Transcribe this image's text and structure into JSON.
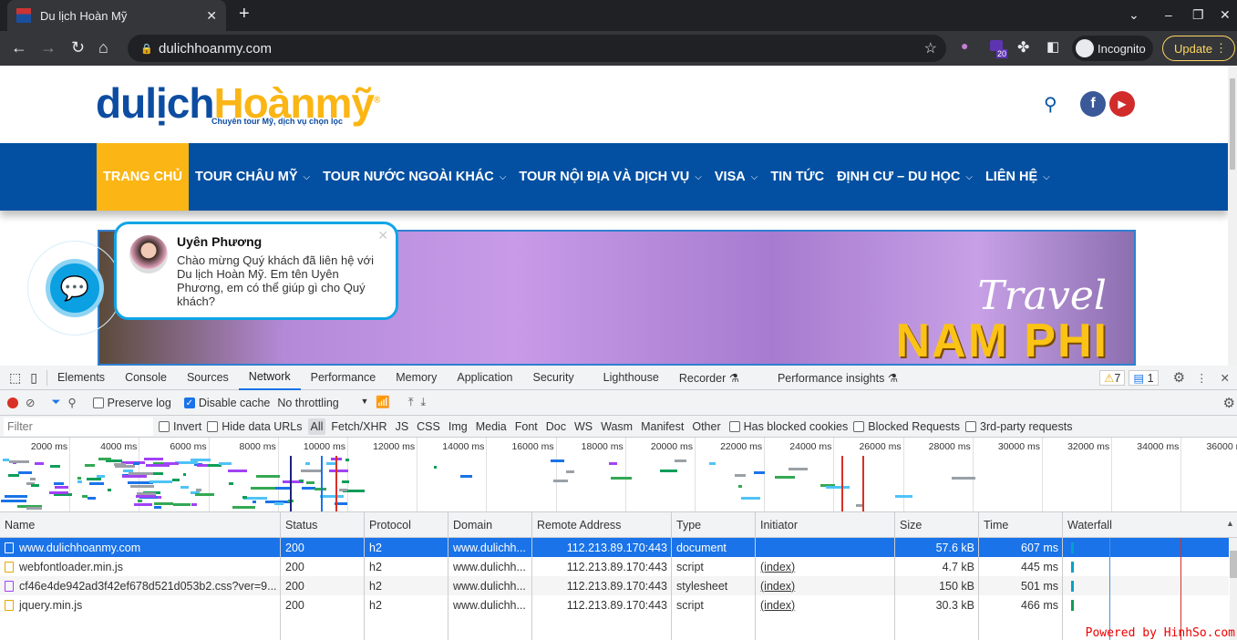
{
  "browser": {
    "tab_title": "Du lịch Hoàn Mỹ",
    "url": "dulichhoanmy.com",
    "incognito_label": "Incognito",
    "update_label": "Update",
    "extension_badge": "20"
  },
  "site": {
    "logo_part1": "dulịch",
    "logo_part2": "Hoànmỹ",
    "logo_mark": "®",
    "slogan": "Chuyên tour Mỹ, dịch vụ chọn lọc",
    "nav": [
      {
        "label": "TRANG CHỦ",
        "active": true,
        "dropdown": false
      },
      {
        "label": "TOUR CHÂU MỸ",
        "dropdown": true
      },
      {
        "label": "TOUR NƯỚC NGOÀI KHÁC",
        "dropdown": true
      },
      {
        "label": "TOUR NỘI ĐỊA VÀ DỊCH VỤ",
        "dropdown": true
      },
      {
        "label": "VISA",
        "dropdown": true
      },
      {
        "label": "TIN TỨC",
        "dropdown": false
      },
      {
        "label": "ĐỊNH CƯ – DU HỌC",
        "dropdown": true
      },
      {
        "label": "LIÊN HỆ",
        "dropdown": true
      }
    ],
    "banner": {
      "line1": "Travel",
      "line2": "NAM PHI"
    },
    "chat": {
      "name": "Uyên Phương",
      "message": "Chào mừng Quý khách đã liên hệ với Du lịch Hoàn Mỹ. Em tên Uyên Phương, em có thể giúp gì cho Quý khách?"
    }
  },
  "devtools": {
    "tabs": [
      "Elements",
      "Console",
      "Sources",
      "Network",
      "Performance",
      "Memory",
      "Application",
      "Security",
      "Lighthouse",
      "Recorder ⚗",
      "Performance insights ⚗"
    ],
    "selected_tab": "Network",
    "warnings": "7",
    "messages": "1",
    "toolbar": {
      "preserve_log": "Preserve log",
      "disable_cache": "Disable cache",
      "throttling": "No throttling"
    },
    "filter": {
      "placeholder": "Filter",
      "invert": "Invert",
      "hide_data_urls": "Hide data URLs",
      "types": [
        "All",
        "Fetch/XHR",
        "JS",
        "CSS",
        "Img",
        "Media",
        "Font",
        "Doc",
        "WS",
        "Wasm",
        "Manifest",
        "Other"
      ],
      "has_blocked_cookies": "Has blocked cookies",
      "blocked_requests": "Blocked Requests",
      "third_party": "3rd-party requests"
    },
    "timeline_ticks": [
      "2000 ms",
      "4000 ms",
      "6000 ms",
      "8000 ms",
      "10000 ms",
      "12000 ms",
      "14000 ms",
      "16000 ms",
      "18000 ms",
      "20000 ms",
      "22000 ms",
      "24000 ms",
      "26000 ms",
      "28000 ms",
      "30000 ms",
      "32000 ms",
      "34000 ms",
      "36000 ms"
    ],
    "columns": [
      "Name",
      "Status",
      "Protocol",
      "Domain",
      "Remote Address",
      "Type",
      "Initiator",
      "Size",
      "Time",
      "Waterfall"
    ],
    "rows": [
      {
        "name": "www.dulichhoanmy.com",
        "status": "200",
        "protocol": "h2",
        "domain": "www.dulichh...",
        "remote": "112.213.89.170:443",
        "type": "document",
        "initiator": "",
        "size": "57.6 kB",
        "time": "607 ms"
      },
      {
        "name": "webfontloader.min.js",
        "status": "200",
        "protocol": "h2",
        "domain": "www.dulichh...",
        "remote": "112.213.89.170:443",
        "type": "script",
        "initiator": "(index)",
        "size": "4.7 kB",
        "time": "445 ms"
      },
      {
        "name": "cf46e4de942ad3f42ef678d521d053b2.css?ver=9...",
        "status": "200",
        "protocol": "h2",
        "domain": "www.dulichh...",
        "remote": "112.213.89.170:443",
        "type": "stylesheet",
        "initiator": "(index)",
        "size": "150 kB",
        "time": "501 ms"
      },
      {
        "name": "jquery.min.js",
        "status": "200",
        "protocol": "h2",
        "domain": "www.dulichh...",
        "remote": "112.213.89.170:443",
        "type": "script",
        "initiator": "(index)",
        "size": "30.3 kB",
        "time": "466 ms"
      }
    ]
  },
  "watermark": "Powered by HinhSo.com"
}
